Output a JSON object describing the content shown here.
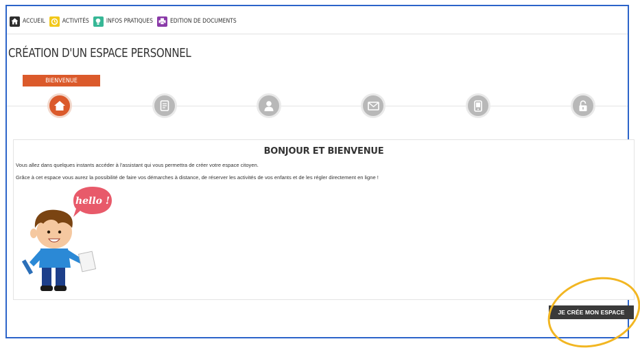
{
  "nav": {
    "items": [
      {
        "label": "ACCUEIL",
        "icon": "home-icon",
        "color": "#2e2e2e"
      },
      {
        "label": "ACTIVITÉS",
        "icon": "clock-icon",
        "color": "#f2c81a"
      },
      {
        "label": "INFOS PRATIQUES",
        "icon": "lightbulb-icon",
        "color": "#37b796"
      },
      {
        "label": "EDITION DE DOCUMENTS",
        "icon": "printer-icon",
        "color": "#8a3aa8"
      }
    ]
  },
  "page": {
    "title": "CRÉATION D'UN ESPACE PERSONNEL"
  },
  "stepper": {
    "active_label": "BIENVENUE",
    "steps": [
      {
        "icon": "home-icon",
        "active": true
      },
      {
        "icon": "document-icon",
        "active": false
      },
      {
        "icon": "user-icon",
        "active": false
      },
      {
        "icon": "envelope-icon",
        "active": false
      },
      {
        "icon": "phone-icon",
        "active": false
      },
      {
        "icon": "lock-icon",
        "active": false
      }
    ]
  },
  "welcome": {
    "title": "BONJOUR ET BIENVENUE",
    "line1": "Vous allez dans quelques instants accéder à l'assistant qui vous permettra de créer votre espace citoyen.",
    "line2": "Grâce à cet espace vous aurez la possibilité de faire vos démarches à distance, de réserver les activités de vos enfants et de les régler directement en ligne !",
    "bubble_text": "hello !"
  },
  "cta": {
    "label": "JE CRÉE MON ESPACE"
  },
  "colors": {
    "frame": "#2b63c9",
    "accent": "#db5a2b",
    "step_inactive": "#b8b8b8",
    "cta_bg": "#3a3a3a",
    "highlight": "#f2b622"
  }
}
